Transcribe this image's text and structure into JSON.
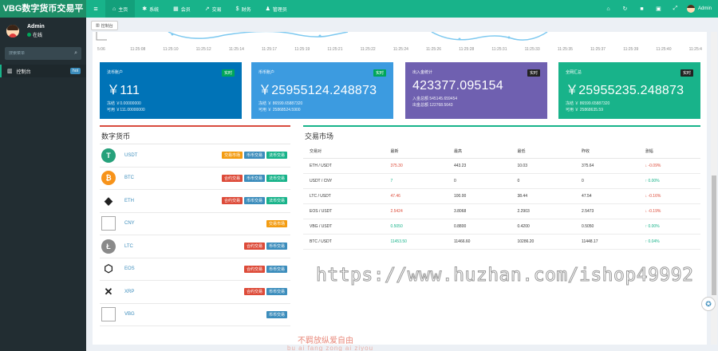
{
  "app": {
    "logo": "VBG数字货币交易平"
  },
  "topnav": {
    "items": [
      {
        "label": "主页",
        "icon": "⌂",
        "active": true
      },
      {
        "label": "系统",
        "icon": "✱"
      },
      {
        "label": "会员",
        "icon": "▦"
      },
      {
        "label": "交易",
        "icon": "↗"
      },
      {
        "label": "财务",
        "icon": "$"
      },
      {
        "label": "管理员",
        "icon": "♟"
      }
    ],
    "user": "Admin"
  },
  "sidebar": {
    "user_name": "Admin",
    "status": "在线",
    "search_placeholder": "搜索菜单",
    "menu_label": "控制台",
    "menu_badge": "hot"
  },
  "tab": {
    "label": "控制台"
  },
  "timeline": [
    "5:06",
    "11:25:08",
    "11:25:10",
    "11:25:12",
    "11:25:14",
    "11:25:17",
    "11:25:19",
    "11:25:21",
    "11:25:22",
    "11:25:24",
    "11:25:26",
    "11:25:28",
    "11:25:31",
    "11:25:33",
    "11:25:35",
    "11:25:37",
    "11:25:39",
    "11:25:40",
    "11:25:4"
  ],
  "cards": [
    {
      "title": "法币账户",
      "badge": "实时",
      "value": "￥111",
      "sub1": "冻结 ￥0.00000000",
      "sub2": "可用 ￥111.00000000",
      "color": "#0073b7",
      "badge_color": "#00a65a"
    },
    {
      "title": "币币账户",
      "badge": "实时",
      "value": "￥25955124.248873",
      "sub1": "冻结 ￥ 86599.65887320",
      "sub2": "可用 ￥ 25868524.5900",
      "color": "#3c9be0",
      "badge_color": "#00a65a"
    },
    {
      "title": "出入金统计",
      "badge": "实时",
      "value": "423377.095154",
      "sub1": "入金总额 545145.659454",
      "sub2": "出金总额 122768.5643",
      "color": "#6f60b0",
      "badge_color": "#222"
    },
    {
      "title": "全网汇总",
      "badge": "实时",
      "value": "￥25955235.248873",
      "sub1": "冻结 ￥ 86599.65887320",
      "sub2": "可用 ￥ 25868635.59",
      "color": "#18b38a",
      "badge_color": "#222"
    }
  ],
  "coins_panel": {
    "title": "数字货币",
    "coins": [
      {
        "name": "USDT",
        "icon": "T",
        "icon_color": "#26a17b",
        "buttons": [
          {
            "label": "交易市场",
            "color": "orange"
          },
          {
            "label": "币币交易",
            "color": "blue"
          },
          {
            "label": "法币交易",
            "color": "teal"
          }
        ]
      },
      {
        "name": "BTC",
        "icon": "₿",
        "icon_color": "#f7931a",
        "buttons": [
          {
            "label": "合约交易",
            "color": "red"
          },
          {
            "label": "币币交易",
            "color": "blue"
          },
          {
            "label": "法币交易",
            "color": "teal"
          }
        ]
      },
      {
        "name": "ETH",
        "icon": "◆",
        "icon_color": "outline",
        "buttons": [
          {
            "label": "合约交易",
            "color": "red"
          },
          {
            "label": "币币交易",
            "color": "blue"
          },
          {
            "label": "法币交易",
            "color": "teal"
          }
        ]
      },
      {
        "name": "CNY",
        "icon": "",
        "icon_color": "broken",
        "buttons": [
          {
            "label": "交易市场",
            "color": "orange"
          }
        ]
      },
      {
        "name": "LTC",
        "icon": "Ł",
        "icon_color": "#8a8a8a",
        "buttons": [
          {
            "label": "合约交易",
            "color": "red"
          },
          {
            "label": "币币交易",
            "color": "blue"
          }
        ]
      },
      {
        "name": "EOS",
        "icon": "⬡",
        "icon_color": "outline",
        "buttons": [
          {
            "label": "合约交易",
            "color": "red"
          },
          {
            "label": "币币交易",
            "color": "blue"
          }
        ]
      },
      {
        "name": "XRP",
        "icon": "✕",
        "icon_color": "outline",
        "buttons": [
          {
            "label": "合约交易",
            "color": "red"
          },
          {
            "label": "币币交易",
            "color": "blue"
          }
        ]
      },
      {
        "name": "VBG",
        "icon": "",
        "icon_color": "broken",
        "buttons": [
          {
            "label": "币币交易",
            "color": "blue"
          }
        ]
      }
    ]
  },
  "market_panel": {
    "title": "交易市场",
    "headers": [
      "交易对",
      "最新",
      "最高",
      "最低",
      "昨收",
      "涨幅"
    ],
    "rows": [
      {
        "pair": "ETH / USDT",
        "last": "375.30",
        "high": "443.23",
        "low": "10.03",
        "prev": "375.64",
        "change": "-0.09%",
        "dir": "down"
      },
      {
        "pair": "USDT / CNY",
        "last": "7",
        "high": "0",
        "low": "0",
        "prev": "0",
        "change": "0.00%",
        "dir": "up"
      },
      {
        "pair": "LTC / USDT",
        "last": "47.46",
        "high": "100.00",
        "low": "38.44",
        "prev": "47.54",
        "change": "-0.16%",
        "dir": "down"
      },
      {
        "pair": "EOS / USDT",
        "last": "2.5424",
        "high": "3.8068",
        "low": "2.2903",
        "prev": "2.5473",
        "change": "-0.19%",
        "dir": "down"
      },
      {
        "pair": "VBG / USDT",
        "last": "0.5050",
        "high": "0.8800",
        "low": "0.4200",
        "prev": "0.5050",
        "change": "0.00%",
        "dir": "up"
      },
      {
        "pair": "BTC / USDT",
        "last": "11453.50",
        "high": "11466.60",
        "low": "10286.20",
        "prev": "11448.17",
        "change": "0.04%",
        "dir": "up"
      }
    ]
  },
  "watermark": "https://www.huzhan.com/ishop49992",
  "footer": {
    "text": "不羁放纵爱自由",
    "sub": "bu ai fang zong ai ziyou"
  }
}
